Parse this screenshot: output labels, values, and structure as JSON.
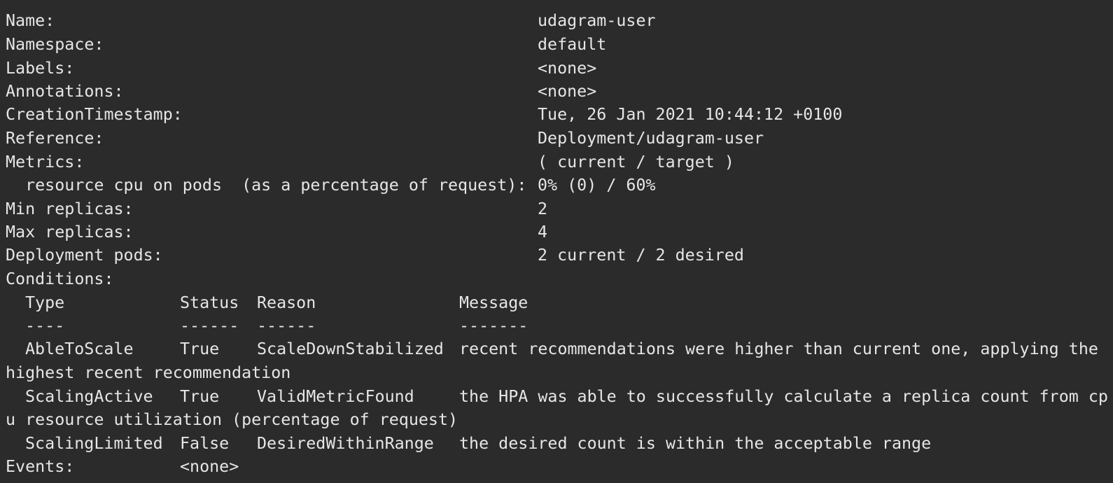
{
  "window": {
    "background": "#2b2b2b",
    "text_color": "#e6e6e6"
  },
  "fields": [
    {
      "label": "Name:",
      "value": "udagram-user"
    },
    {
      "label": "Namespace:",
      "value": "default"
    },
    {
      "label": "Labels:",
      "value": "<none>"
    },
    {
      "label": "Annotations:",
      "value": "<none>"
    },
    {
      "label": "CreationTimestamp:",
      "value": "Tue, 26 Jan 2021 10:44:12 +0100"
    },
    {
      "label": "Reference:",
      "value": "Deployment/udagram-user"
    },
    {
      "label": "Metrics:",
      "value": "( current / target )"
    },
    {
      "label": "  resource cpu on pods  (as a percentage of request):",
      "value": "0% (0) / 60%"
    },
    {
      "label": "Min replicas:",
      "value": "2"
    },
    {
      "label": "Max replicas:",
      "value": "4"
    },
    {
      "label": "Deployment pods:",
      "value": "2 current / 2 desired"
    }
  ],
  "conditions": {
    "heading": "Conditions:",
    "columns": [
      "Type",
      "Status",
      "Reason",
      "Message"
    ],
    "underlines": [
      "----",
      "------",
      "------",
      "-------"
    ],
    "rows": [
      {
        "type": "AbleToScale",
        "status": "True",
        "reason": "ScaleDownStabilized",
        "message": "recent recommendations were higher than current one, applying the",
        "continuation": "highest recent recommendation"
      },
      {
        "type": "ScalingActive",
        "status": "True",
        "reason": "ValidMetricFound",
        "message": "the HPA was able to successfully calculate a replica count from cp",
        "continuation": "u resource utilization (percentage of request)"
      },
      {
        "type": "ScalingLimited",
        "status": "False",
        "reason": "DesiredWithinRange",
        "message": "the desired count is within the acceptable range",
        "continuation": ""
      }
    ]
  },
  "events": {
    "label": "Events:",
    "value": "<none>"
  }
}
